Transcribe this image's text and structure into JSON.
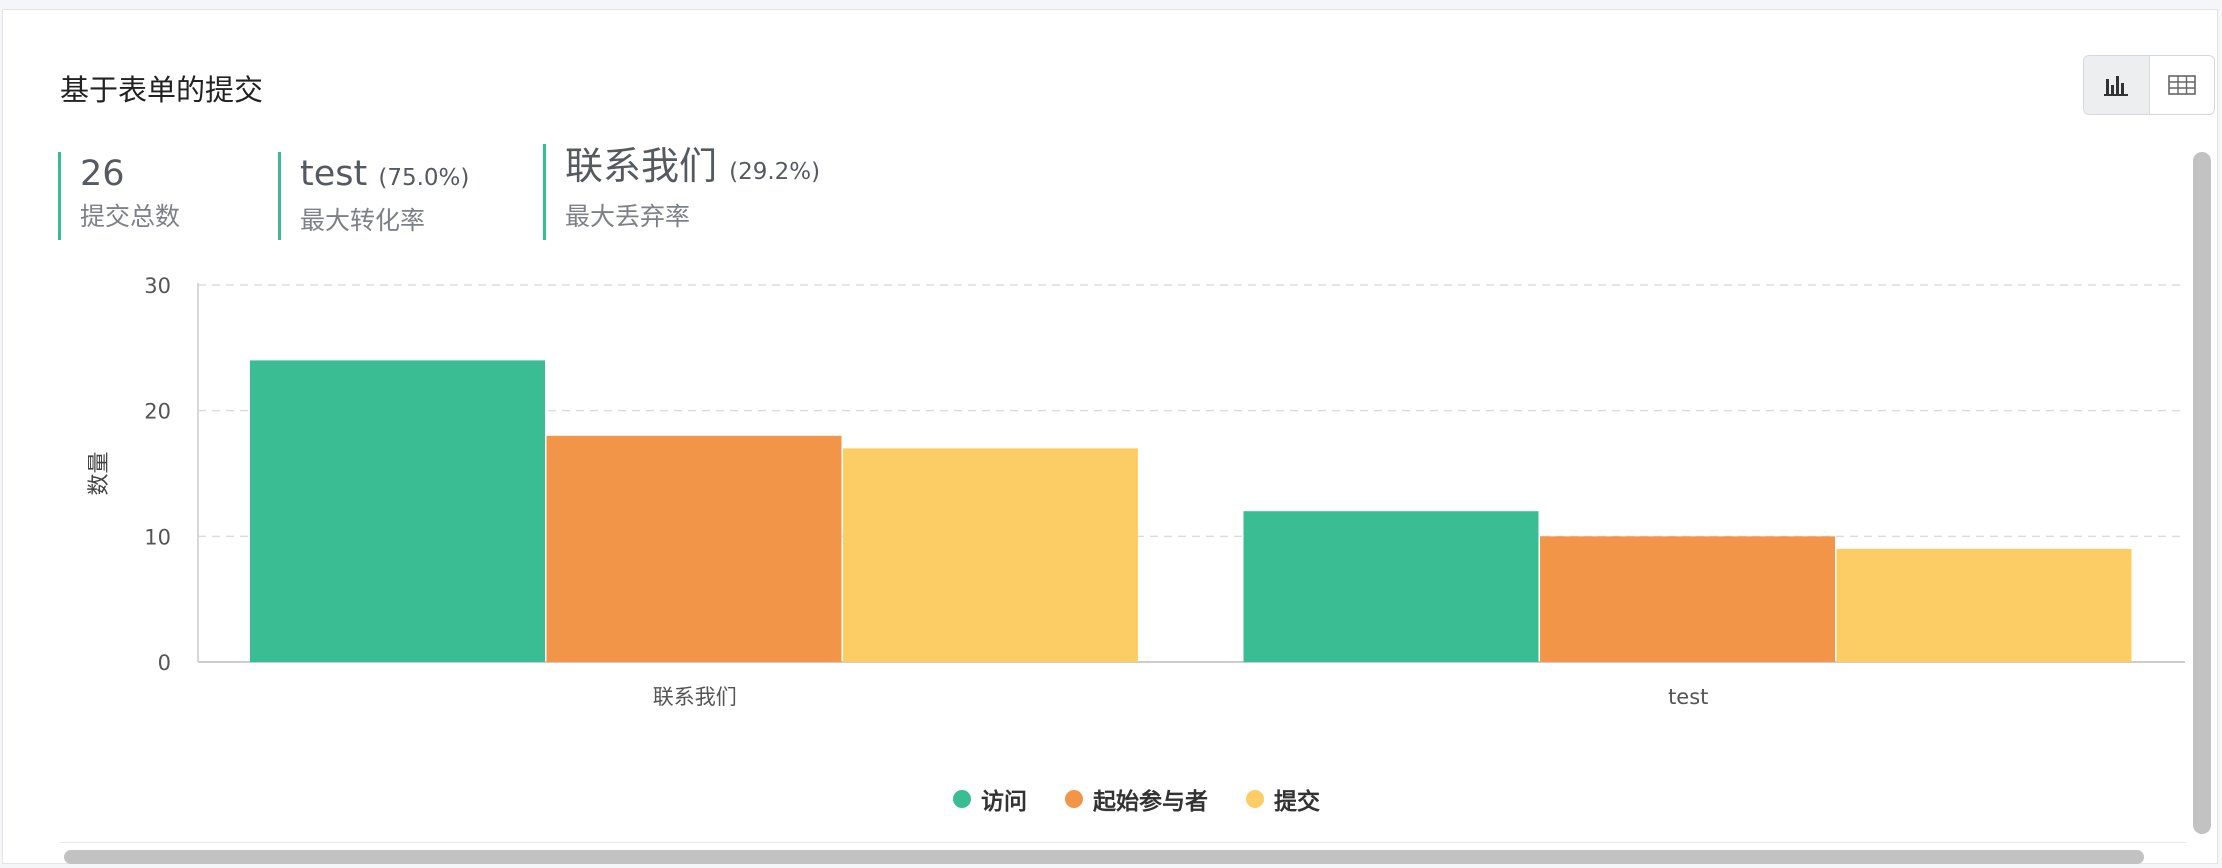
{
  "panel": {
    "title": "基于表单的提交"
  },
  "toggle": {
    "chart_icon": "bar-chart-icon",
    "table_icon": "table-icon"
  },
  "stats": [
    {
      "value": "26",
      "pct": "",
      "label": "提交总数"
    },
    {
      "value": "test",
      "pct": "(75.0%)",
      "label": "最大转化率"
    },
    {
      "value": "联系我们",
      "pct": "(29.2%)",
      "label": "最大丢弃率"
    }
  ],
  "colors": {
    "accent": "#3bbd93",
    "series_visit": "#3bbd93",
    "series_start": "#f29548",
    "series_submit": "#fbcd64",
    "grid": "#dddddd",
    "axis": "#cccccc"
  },
  "chart_data": {
    "type": "bar",
    "title": "",
    "xlabel": "",
    "ylabel": "数量",
    "categories": [
      "联系我们",
      "test"
    ],
    "series": [
      {
        "name": "访问",
        "values": [
          24,
          12
        ],
        "color": "#3bbd93"
      },
      {
        "name": "起始参与者",
        "values": [
          18,
          10
        ],
        "color": "#f29548"
      },
      {
        "name": "提交",
        "values": [
          17,
          9
        ],
        "color": "#fbcd64"
      }
    ],
    "ylim": [
      0,
      30
    ],
    "yticks": [
      0,
      10,
      20,
      30
    ],
    "grid": true,
    "legend": "bottom-center"
  }
}
